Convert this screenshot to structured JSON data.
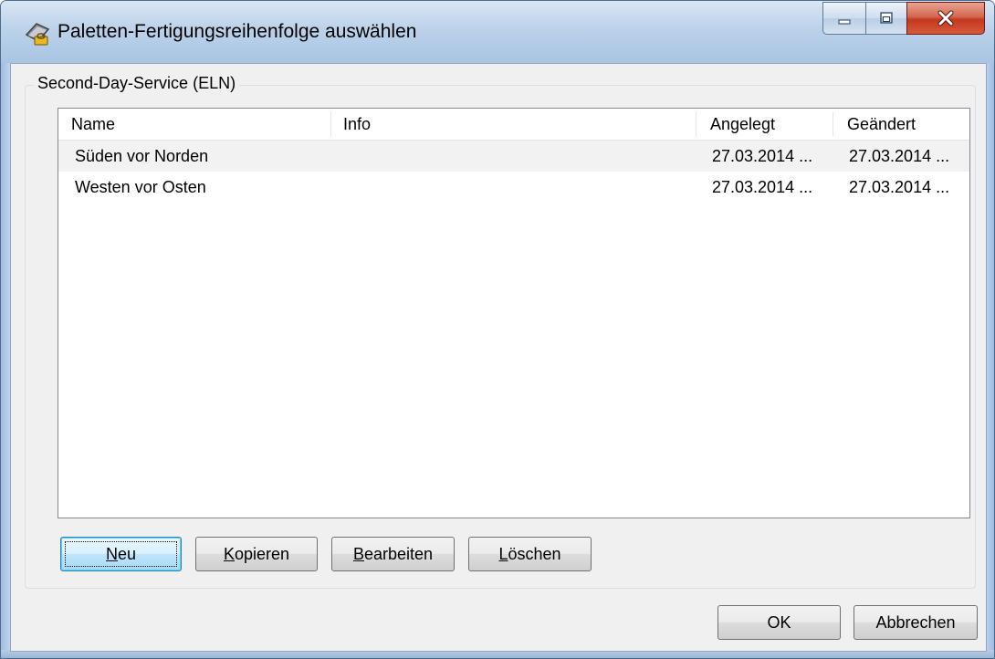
{
  "window": {
    "title": "Paletten-Fertigungsreihenfolge auswählen",
    "minimize_label": "minimize",
    "maximize_label": "maximize",
    "close_label": "close"
  },
  "group": {
    "label": "Second-Day-Service (ELN)"
  },
  "list": {
    "columns": [
      "Name",
      "Info",
      "Angelegt",
      "Geändert"
    ],
    "rows": [
      {
        "name": "Süden vor Norden",
        "info": "",
        "angelegt": "27.03.2014 ...",
        "geaendert": "27.03.2014 ..."
      },
      {
        "name": "Westen vor Osten",
        "info": "",
        "angelegt": "27.03.2014 ...",
        "geaendert": "27.03.2014 ..."
      }
    ],
    "selected_row": 0
  },
  "buttons": {
    "neu": {
      "mnemonic": "N",
      "rest": "eu"
    },
    "kopieren": {
      "mnemonic": "K",
      "rest": "opieren"
    },
    "bearbeiten": {
      "mnemonic": "B",
      "rest": "earbeiten"
    },
    "loeschen": {
      "mnemonic": "L",
      "rest": "öschen"
    },
    "ok": "OK",
    "abbrechen": "Abbrechen"
  },
  "colors": {
    "title_bar": "#bcd2ea",
    "close_button": "#c4381f",
    "default_button_border": "#3c7fb1",
    "dialog_background": "#f0f0f0"
  }
}
